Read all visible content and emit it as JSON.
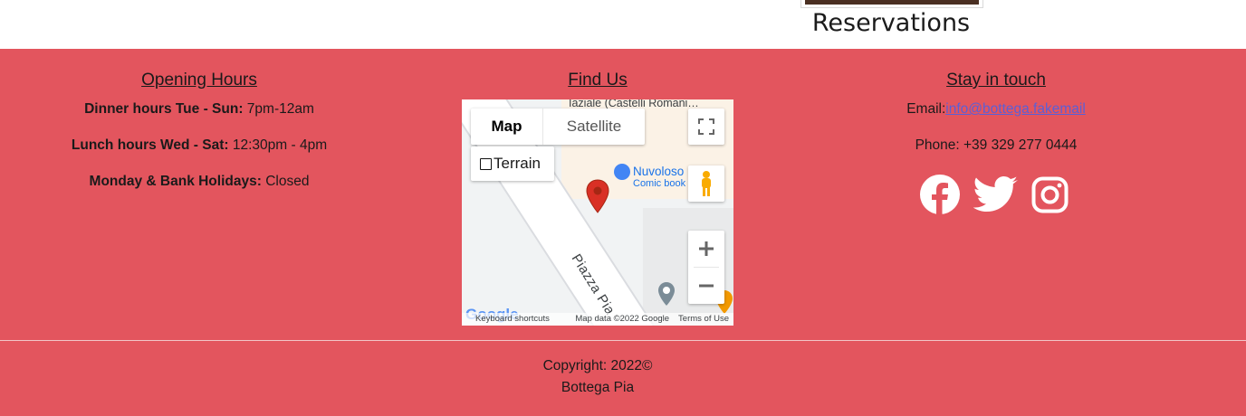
{
  "header": {
    "reservations_title": "Reservations"
  },
  "opening_hours": {
    "title": "Opening Hours",
    "lines": [
      {
        "label": "Dinner hours Tue - Sun:",
        "value": "7pm-12am"
      },
      {
        "label": "Lunch hours Wed - Sat:",
        "value": "12:30pm - 4pm"
      },
      {
        "label": "Monday & Bank Holidays:",
        "value": "Closed"
      }
    ]
  },
  "find_us": {
    "title": "Find Us",
    "map": {
      "type_map_label": "Map",
      "type_satellite_label": "Satellite",
      "terrain_label": "Terrain",
      "top_street_label": "Iaziale (Castelli Romani…",
      "poi_name": "Nuvoloso",
      "poi_sub": "Comic book",
      "road_label": "Piazza Pia",
      "keyboard_shortcuts": "Keyboard shortcuts",
      "map_data": "Map data ©2022 Google",
      "terms": "Terms of Use",
      "logo": "Google",
      "icons": [
        "fullscreen-icon",
        "pegman-icon",
        "zoom-in-icon",
        "zoom-out-icon",
        "map-pin-icon"
      ],
      "pin_color": "#d93025"
    }
  },
  "stay_in_touch": {
    "title": "Stay in touch",
    "email_label": "Email:",
    "email_value": "info@bottega.fakemail",
    "phone": "Phone: +39 329 277 0444",
    "social_icons": [
      "facebook-icon",
      "twitter-icon",
      "instagram-icon"
    ]
  },
  "copyright": {
    "line1": "Copyright: 2022©",
    "line2": "Bottega Pia"
  },
  "colors": {
    "footer_bg": "#e3555e",
    "link": "#5b5fd6"
  }
}
